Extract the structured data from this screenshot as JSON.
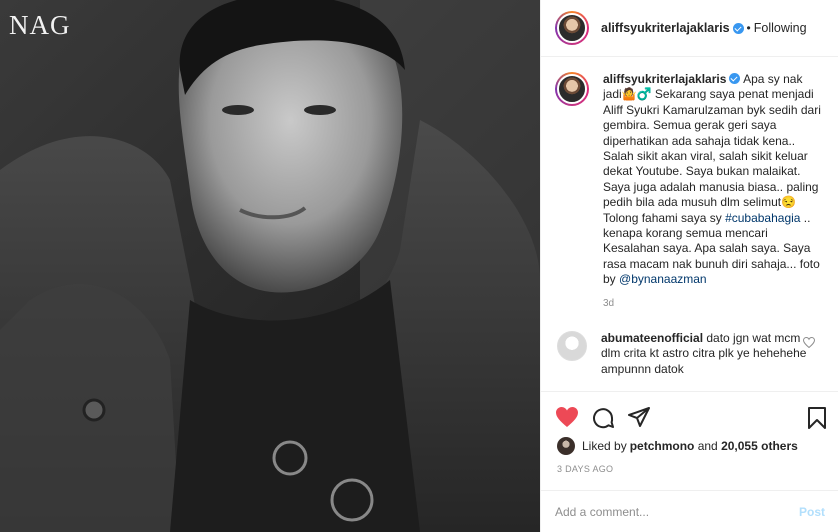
{
  "photo": {
    "watermark": "NAG"
  },
  "header": {
    "username": "aliffsyukriterlajaklaris",
    "dot": "•",
    "follow_status": "Following"
  },
  "caption": {
    "username": "aliffsyukriterlajaklaris",
    "text_before": " Apa sy nak jadi🤷♂️ Sekarang saya penat menjadi Aliff Syukri Kamarulzaman byk sedih dari gembira. Semua gerak geri saya diperhatikan ada sahaja tidak kena.. Salah sikit akan viral, salah sikit keluar dekat Youtube. Saya bukan malaikat. Saya juga adalah manusia biasa.. paling pedih bila ada musuh dlm selimut😒 Tolong fahami saya sy ",
    "hashtag": "#cubabahagia",
    "text_middle": " .. kenapa korang semua mencari Kesalahan saya. Apa salah saya. Saya rasa macam nak bunuh diri sahaja... foto by ",
    "mention": "@bynanaazman",
    "age": "3d"
  },
  "comment": {
    "username": "abumateenofficial",
    "text": " dato jgn wat mcm dlm crita kt astro citra plk ye hehehehe ampunnn datok"
  },
  "likes": {
    "prefix": "Liked by ",
    "user": "petchmono",
    "middle": " and ",
    "count": "20,055 others"
  },
  "post_date": "3 DAYS AGO",
  "add_comment": {
    "placeholder": "Add a comment...",
    "post_label": "Post"
  },
  "colors": {
    "accent": "#3897f0",
    "heart": "#ed4956",
    "link": "#00376b"
  }
}
